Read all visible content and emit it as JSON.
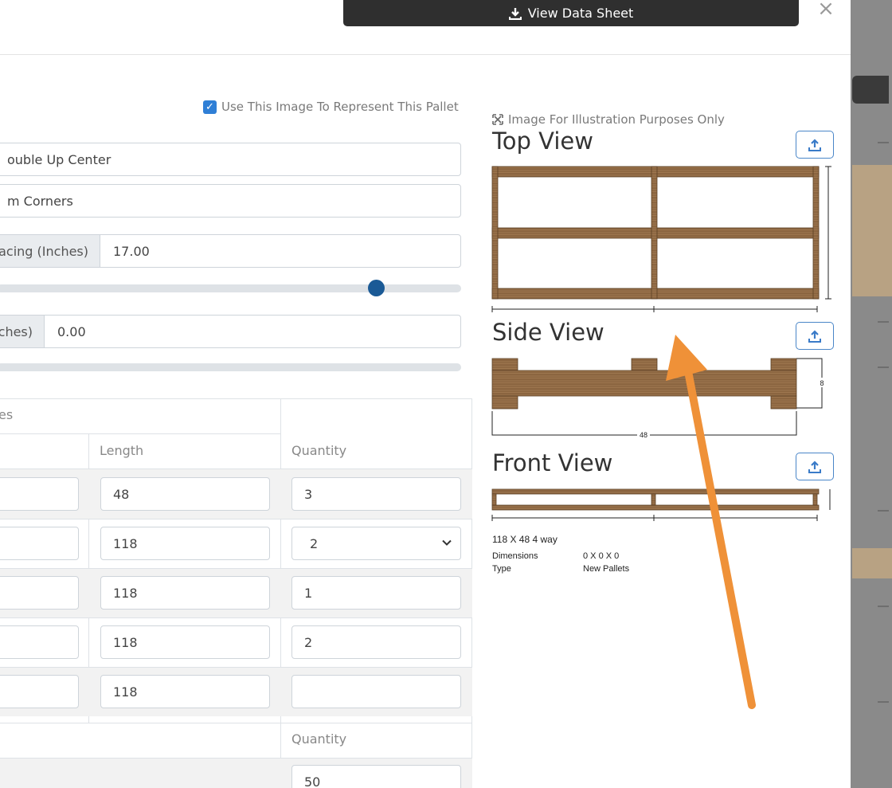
{
  "header": {
    "datasheet_label": "View Data Sheet",
    "close_glyph": "×"
  },
  "form": {
    "use_image_label": "Use This Image To Represent This Pallet",
    "field1": "ouble Up Center",
    "field2": "m Corners",
    "spacing_label": "pacing (Inches)",
    "spacing_value": "17.00",
    "spacing_slider_level": 0.8,
    "inches_label": "ches)",
    "inches_value": "0.00",
    "inches_slider_level": 0.0
  },
  "table": {
    "group_header": "es",
    "col_length": "Length",
    "col_quantity": "Quantity",
    "rows": [
      {
        "length": "48",
        "quantity": "3"
      },
      {
        "length": "118",
        "quantity": "2"
      },
      {
        "length": "118",
        "quantity": "1"
      },
      {
        "length": "118",
        "quantity": "2"
      },
      {
        "length": "118",
        "quantity": ""
      }
    ],
    "footer_quantity_label": "Quantity",
    "footer_quantity_value": "50"
  },
  "views": {
    "note": "Image For Illustration Purposes Only",
    "top": "Top View",
    "side": "Side View",
    "front": "Front View",
    "side_width": "48",
    "side_height": "8"
  },
  "summary": {
    "title": "118 X 48 4 way",
    "dimensions_label": "Dimensions",
    "dimensions_value": "0 X 0 X 0",
    "type_label": "Type",
    "type_value": "New Pallets"
  },
  "colors": {
    "accent": "#2f7fd6",
    "slider": "#1b5a96",
    "wood": "#8b6540",
    "arrow": "#ef9138"
  }
}
